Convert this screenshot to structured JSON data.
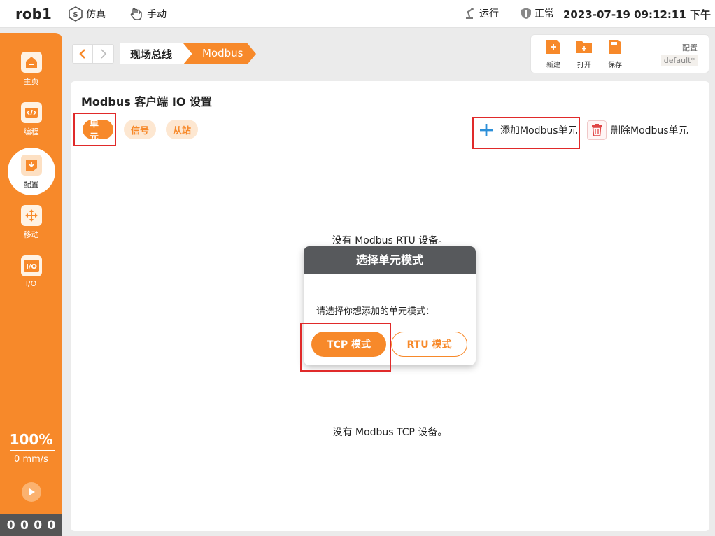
{
  "topbar": {
    "robot_name": "rob1",
    "simulate_label": "仿真",
    "manual_label": "手动",
    "run_label": "运行",
    "status_label": "正常",
    "datetime": "2023-07-19 09:12:11 下午"
  },
  "sidebar": {
    "items": [
      {
        "label": "主页",
        "icon": "home-icon"
      },
      {
        "label": "编程",
        "icon": "code-icon"
      },
      {
        "label": "配置",
        "icon": "config-icon"
      },
      {
        "label": "移动",
        "icon": "move-icon"
      },
      {
        "label": "I/O",
        "icon": "io-icon"
      }
    ],
    "speed_percent": "100%",
    "speed_value": "0 mm/s",
    "counters": [
      "0",
      "0",
      "0",
      "0"
    ]
  },
  "breadcrumb": {
    "items": [
      "现场总线",
      "Modbus"
    ]
  },
  "filetools": {
    "new_label": "新建",
    "open_label": "打开",
    "save_label": "保存",
    "config_label": "配置",
    "config_value": "default*"
  },
  "panel": {
    "title": "Modbus 客户端 IO 设置",
    "tabs": [
      "单元",
      "信号",
      "从站"
    ],
    "add_label": "添加Modbus单元",
    "delete_label": "删除Modbus单元",
    "empty_rtu": "没有 Modbus RTU 设备。",
    "empty_tcp": "没有 Modbus TCP 设备。"
  },
  "dialog": {
    "title": "选择单元模式",
    "prompt": "请选择你想添加的单元模式：",
    "tcp_label": "TCP 模式",
    "rtu_label": "RTU 模式"
  },
  "colors": {
    "accent": "#f7892a",
    "highlight": "#e02a2a",
    "dialog_header": "#57595c"
  }
}
